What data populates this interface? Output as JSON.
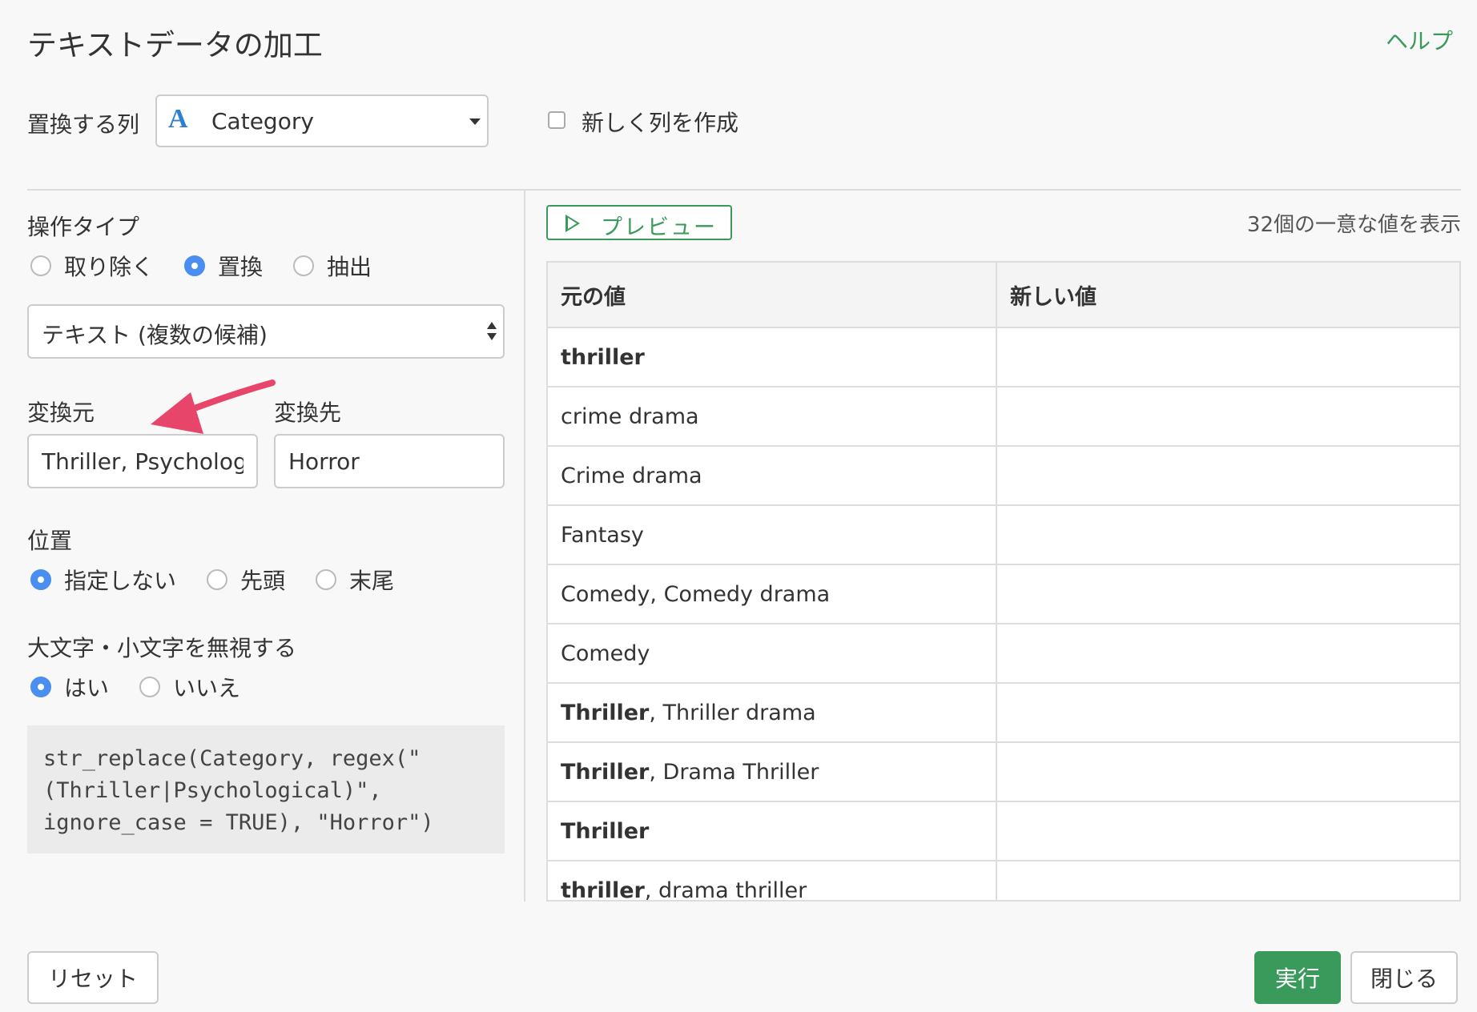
{
  "dialog": {
    "title": "テキストデータの加工",
    "help_label": "ヘルプ"
  },
  "column": {
    "label": "置換する列",
    "type_icon": "A",
    "selected": "Category",
    "new_column_label": "新しく列を作成",
    "new_column_checked": false
  },
  "operation": {
    "label": "操作タイプ",
    "options": [
      "取り除く",
      "置換",
      "抽出"
    ],
    "selected": "置換"
  },
  "method": {
    "selected": "テキスト (複数の候補)"
  },
  "replace": {
    "from_label": "変換元",
    "to_label": "変換先",
    "from_value": "Thriller, Psychological",
    "to_value": "Horror"
  },
  "position": {
    "label": "位置",
    "options": [
      "指定しない",
      "先頭",
      "末尾"
    ],
    "selected": "指定しない"
  },
  "ignore_case": {
    "label": "大文字・小文字を無視する",
    "options": [
      "はい",
      "いいえ"
    ],
    "selected": "はい"
  },
  "code": {
    "lines": [
      "str_replace(Category, regex(\"",
      "(Thriller|Psychological)\",",
      "ignore_case = TRUE), \"Horror\")"
    ]
  },
  "preview": {
    "button_label": "プレビュー",
    "count_text": "32個の一意な値を表示",
    "headers": [
      "元の値",
      "新しい値"
    ],
    "rows": [
      {
        "match": "thriller",
        "rest": "",
        "new": ""
      },
      {
        "match": "",
        "rest": "crime drama",
        "new": ""
      },
      {
        "match": "",
        "rest": "Crime drama",
        "new": ""
      },
      {
        "match": "",
        "rest": "Fantasy",
        "new": ""
      },
      {
        "match": "",
        "rest": "Comedy, Comedy drama",
        "new": ""
      },
      {
        "match": "",
        "rest": "Comedy",
        "new": ""
      },
      {
        "match": "Thriller",
        "rest": ", Thriller drama",
        "new": ""
      },
      {
        "match": "Thriller",
        "rest": ", Drama Thriller",
        "new": ""
      },
      {
        "match": "Thriller",
        "rest": "",
        "new": ""
      },
      {
        "match": "thriller",
        "rest": ", drama thriller",
        "new": ""
      }
    ]
  },
  "footer": {
    "reset_label": "リセット",
    "run_label": "実行",
    "close_label": "閉じる"
  },
  "colors": {
    "accent_green": "#3a9a5b",
    "radio_blue": "#4a8ef0",
    "arrow_pink": "#e8456b"
  }
}
